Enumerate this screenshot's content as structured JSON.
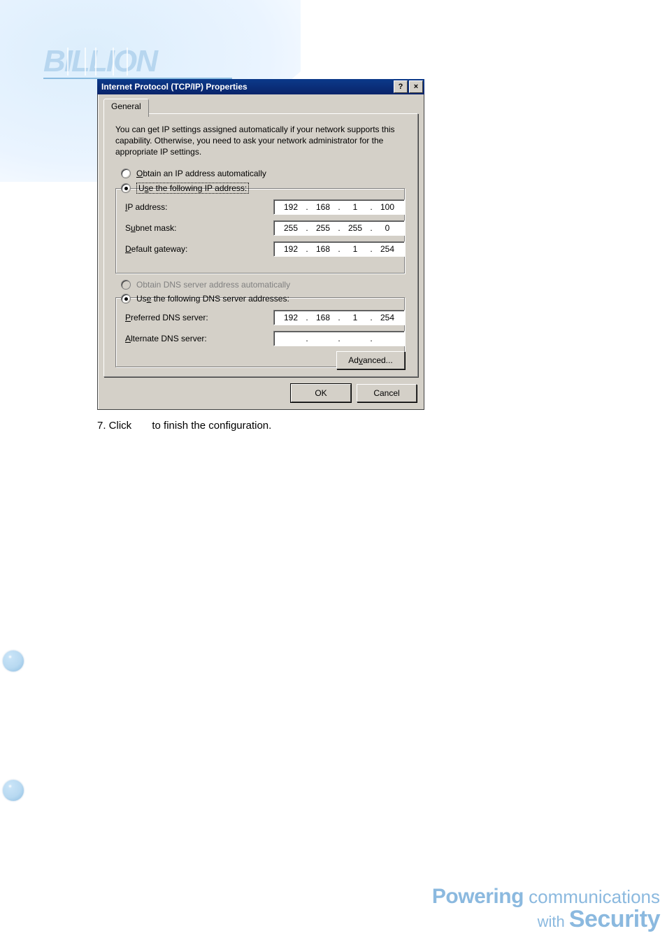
{
  "dialog": {
    "title": "Internet Protocol (TCP/IP) Properties",
    "help_glyph": "?",
    "close_glyph": "×",
    "tab_label": "General",
    "description": "You can get IP settings assigned automatically if your network supports this capability. Otherwise, you need to ask your network administrator for the appropriate IP settings.",
    "radio_ip_auto": "Obtain an IP address automatically",
    "radio_ip_manual": "Use the following IP address:",
    "label_ip": "IP address:",
    "label_subnet": "Subnet mask:",
    "label_gateway": "Default gateway:",
    "radio_dns_auto": "Obtain DNS server address automatically",
    "radio_dns_manual": "Use the following DNS server addresses:",
    "label_pref_dns": "Preferred DNS server:",
    "label_alt_dns": "Alternate DNS server:",
    "ip_address": {
      "o1": "192",
      "o2": "168",
      "o3": "1",
      "o4": "100"
    },
    "subnet_mask": {
      "o1": "255",
      "o2": "255",
      "o3": "255",
      "o4": "0"
    },
    "gateway": {
      "o1": "192",
      "o2": "168",
      "o3": "1",
      "o4": "254"
    },
    "pref_dns": {
      "o1": "192",
      "o2": "168",
      "o3": "1",
      "o4": "254"
    },
    "alt_dns": {
      "o1": "",
      "o2": "",
      "o3": "",
      "o4": ""
    },
    "dot": ".",
    "btn_advanced": "Advanced...",
    "btn_ok": "OK",
    "btn_cancel": "Cancel"
  },
  "step": {
    "prefix": "7. Click",
    "suffix": "to finish the configuration."
  },
  "tagline": {
    "word1_strong": "Powering",
    "word1_rest": " communications",
    "word2_small": "with ",
    "word2_big": "Security"
  }
}
